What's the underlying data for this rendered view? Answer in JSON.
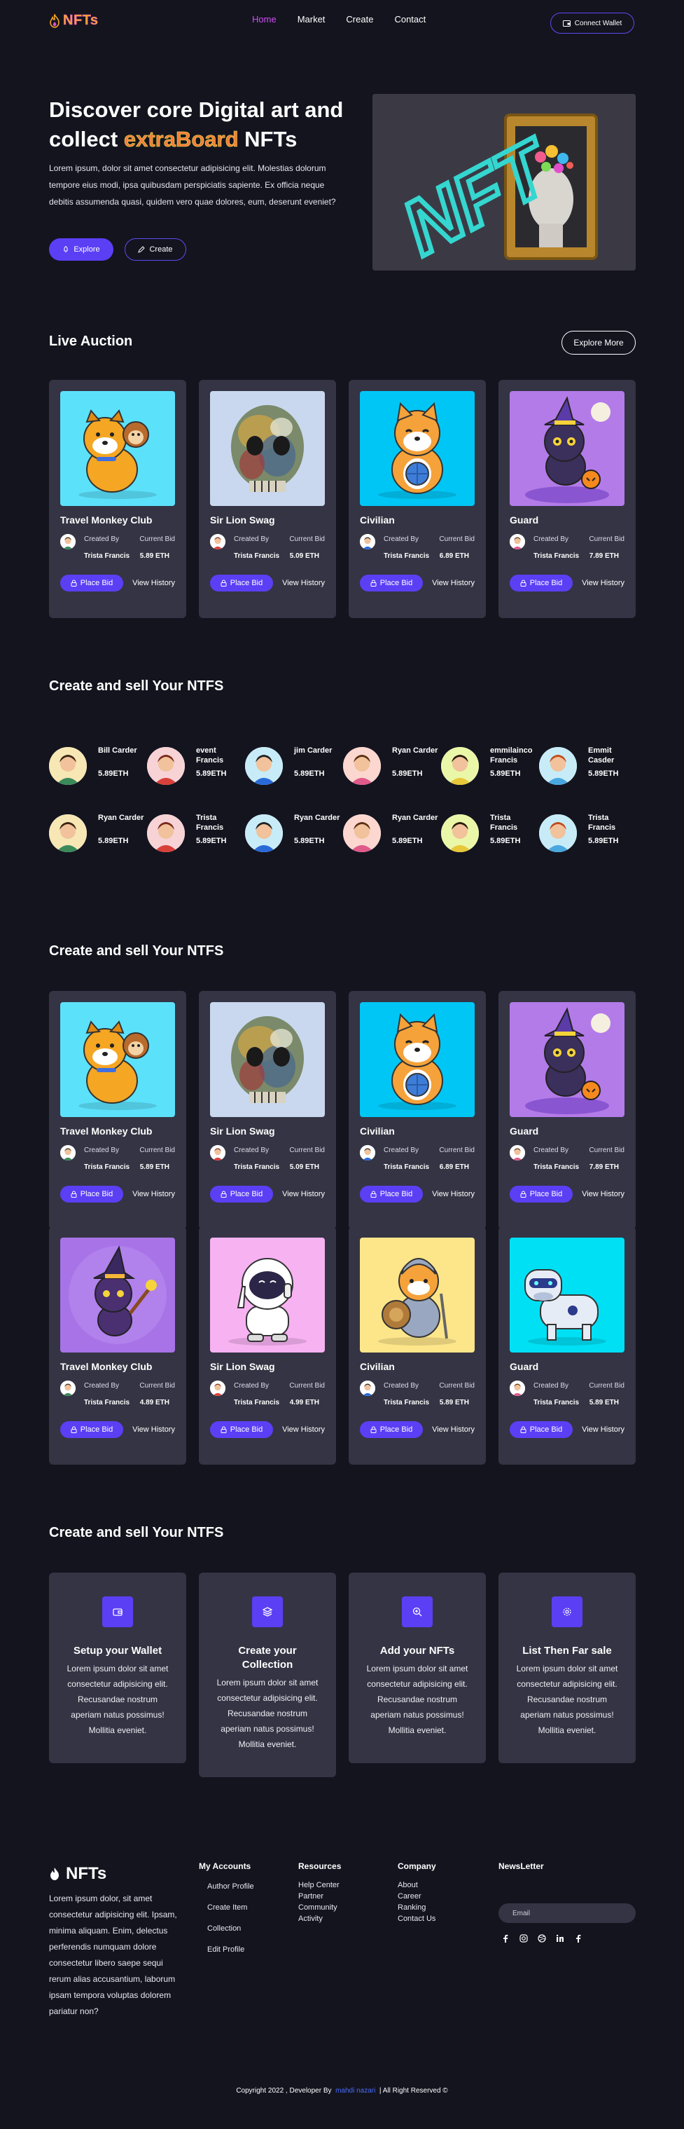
{
  "nav": {
    "brand": "NFTs",
    "links": [
      "Home",
      "Market",
      "Create",
      "Contact"
    ],
    "connect_label": "Connect Wallet"
  },
  "hero": {
    "title_line1": "Discover core Digital art and",
    "title_prefix": "collect",
    "title_highlight": "extraBoard",
    "title_suffix": "NFTs",
    "description": "Lorem ipsum, dolor sit amet consectetur adipisicing elit. Molestias dolorum tempore eius modi, ipsa quibusdam perspiciatis sapiente. Ex officia neque debitis assumenda quasi, quidem vero quae dolores, eum, deserunt eveniet?",
    "explore_label": "Explore",
    "create_label": "Create",
    "image_text": "NFT"
  },
  "auction": {
    "title": "Live Auction",
    "explore_more_label": "Explore More"
  },
  "card_labels": {
    "created_by": "Created By",
    "current_bid": "Current Bid",
    "place_bid": "Place Bid",
    "view_history": "View History"
  },
  "auction_cards": [
    {
      "name": "Travel Monkey Club",
      "creator": "Trista Francis",
      "price": "5.89 ETH",
      "art": "dog-monkey",
      "bg": "#5ce1fb"
    },
    {
      "name": "Sir Lion Swag",
      "creator": "Trista Francis",
      "price": "5.09 ETH",
      "art": "skull",
      "bg": "#c9d8ee"
    },
    {
      "name": "Civilian",
      "creator": "Trista Francis",
      "price": "6.89 ETH",
      "art": "shiba",
      "bg": "#00c6f5"
    },
    {
      "name": "Guard",
      "creator": "Trista Francis",
      "price": "7.89 ETH",
      "art": "witch-cat",
      "bg": "#b37be8"
    }
  ],
  "creators_section": {
    "title": "Create and sell Your NTFS",
    "row1": [
      {
        "name": "Bill Carder",
        "price": "5.89ETH",
        "bg": "#f6e7b4"
      },
      {
        "name": "event Francis",
        "price": "5.89ETH",
        "bg": "#f7d3d6"
      },
      {
        "name": "jim Carder",
        "price": "5.89ETH",
        "bg": "#c7ecf7"
      },
      {
        "name": "Ryan Carder",
        "price": "5.89ETH",
        "bg": "#fbd7d0"
      },
      {
        "name": "emmilainco Francis",
        "price": "5.89ETH",
        "bg": "#eaf7a8"
      },
      {
        "name": "Emmit Casder",
        "price": "5.89ETH",
        "bg": "#c7ecf7"
      }
    ],
    "row2": [
      {
        "name": "Ryan Carder",
        "price": "5.89ETH",
        "bg": "#f6e7b4"
      },
      {
        "name": "Trista Francis",
        "price": "5.89ETH",
        "bg": "#f7d3d6"
      },
      {
        "name": "Ryan Carder",
        "price": "5.89ETH",
        "bg": "#c7ecf7"
      },
      {
        "name": "Ryan Carder",
        "price": "5.89ETH",
        "bg": "#fbd7d0"
      },
      {
        "name": "Trista Francis",
        "price": "5.89ETH",
        "bg": "#eaf7a8"
      },
      {
        "name": "Trista Francis",
        "price": "5.89ETH",
        "bg": "#c7ecf7"
      }
    ]
  },
  "market": {
    "title": "Create and sell Your NTFS",
    "row1": [
      {
        "name": "Travel Monkey Club",
        "creator": "Trista Francis",
        "price": "5.89 ETH",
        "art": "dog-monkey",
        "bg": "#5ce1fb"
      },
      {
        "name": "Sir Lion Swag",
        "creator": "Trista Francis",
        "price": "5.09 ETH",
        "art": "skull",
        "bg": "#c9d8ee"
      },
      {
        "name": "Civilian",
        "creator": "Trista Francis",
        "price": "6.89 ETH",
        "art": "shiba",
        "bg": "#00c6f5"
      },
      {
        "name": "Guard",
        "creator": "Trista Francis",
        "price": "7.89 ETH",
        "art": "witch-cat",
        "bg": "#b37be8"
      }
    ],
    "row2": [
      {
        "name": "Travel Monkey Club",
        "creator": "Trista Francis",
        "price": "4.89 ETH",
        "art": "wizard-cat",
        "bg": "#a873e6"
      },
      {
        "name": "Sir Lion Swag",
        "creator": "Trista Francis",
        "price": "4.99 ETH",
        "art": "astronaut",
        "bg": "#f7b2f2"
      },
      {
        "name": "Civilian",
        "creator": "Trista Francis",
        "price": "5.89 ETH",
        "art": "knight-dog",
        "bg": "#fde68a"
      },
      {
        "name": "Guard",
        "creator": "Trista Francis",
        "price": "5.89 ETH",
        "art": "robot-cow",
        "bg": "#00e0f5"
      }
    ]
  },
  "steps_section": {
    "title": "Create and sell Your NTFS",
    "items": [
      {
        "title": "Setup your Wallet",
        "text": "Lorem ipsum dolor sit amet consectetur adipisicing elit. Recusandae nostrum aperiam natus possimus! Mollitia eveniet.",
        "icon": "wallet-icon"
      },
      {
        "title": "Create your Collection",
        "text": "Lorem ipsum dolor sit amet consectetur adipisicing elit. Recusandae nostrum aperiam natus possimus! Mollitia eveniet.",
        "icon": "layers-icon"
      },
      {
        "title": "Add your NFTs",
        "text": "Lorem ipsum dolor sit amet consectetur adipisicing elit. Recusandae nostrum aperiam natus possimus! Mollitia eveniet.",
        "icon": "zoom-in-icon"
      },
      {
        "title": "List Then Far sale",
        "text": "Lorem ipsum dolor sit amet consectetur adipisicing elit. Recusandae nostrum aperiam natus possimus! Mollitia eveniet.",
        "icon": "settings-icon"
      }
    ]
  },
  "footer": {
    "brand": "NFTs",
    "description": "Lorem ipsum dolor, sit amet consectetur adipisicing elit. Ipsam, minima aliquam. Enim, delectus perferendis numquam dolore consectetur libero saepe sequi rerum alias accusantium, laborum ipsam tempora voluptas dolorem pariatur non?",
    "accounts": {
      "title": "My Accounts",
      "items": [
        "Author Profile",
        "Create Item",
        "Collection",
        "Edit Profile"
      ]
    },
    "resources": {
      "title": "Resources",
      "items": [
        "Help Center",
        "Partner",
        "Community",
        "Activity"
      ]
    },
    "company": {
      "title": "Company",
      "items": [
        "About",
        "Career",
        "Ranking",
        "Contact Us"
      ]
    },
    "newsletter": {
      "title": "NewsLetter",
      "placeholder": "Email"
    },
    "copyright_prefix": "Copyright 2022 , Developer By",
    "developer": "mahdi nazari",
    "copyright_suffix": "| All Right Reserved ©"
  }
}
